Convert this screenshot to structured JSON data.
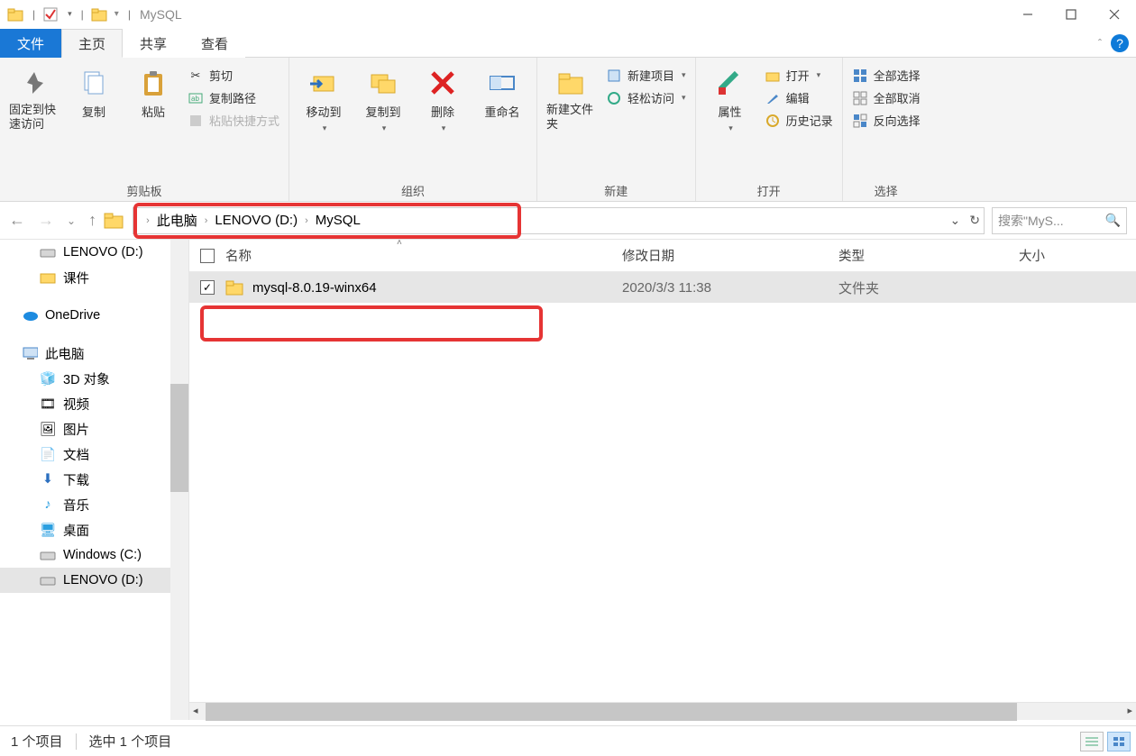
{
  "window": {
    "title": "MySQL",
    "min_tooltip": "最小化",
    "max_tooltip": "最大化",
    "close_tooltip": "关闭"
  },
  "tabs": {
    "file": "文件",
    "home": "主页",
    "share": "共享",
    "view": "查看"
  },
  "ribbon": {
    "clipboard": {
      "label": "剪贴板",
      "pin": "固定到快速访问",
      "copy": "复制",
      "paste": "粘贴",
      "cut": "剪切",
      "copy_path": "复制路径",
      "paste_shortcut": "粘贴快捷方式"
    },
    "organize": {
      "label": "组织",
      "move_to": "移动到",
      "copy_to": "复制到",
      "delete": "删除",
      "rename": "重命名"
    },
    "new": {
      "label": "新建",
      "new_folder": "新建文件夹",
      "new_item": "新建项目",
      "easy_access": "轻松访问"
    },
    "open": {
      "label": "打开",
      "properties": "属性",
      "open": "打开",
      "edit": "编辑",
      "history": "历史记录"
    },
    "select": {
      "label": "选择",
      "select_all": "全部选择",
      "select_none": "全部取消",
      "invert": "反向选择"
    }
  },
  "breadcrumb": {
    "pc": "此电脑",
    "drive": "LENOVO (D:)",
    "folder": "MySQL"
  },
  "search": {
    "placeholder": "搜索\"MyS..."
  },
  "tree": {
    "lenovo_d": "LENOVO (D:)",
    "courseware": "课件",
    "onedrive": "OneDrive",
    "this_pc": "此电脑",
    "threed": "3D 对象",
    "videos": "视频",
    "pictures": "图片",
    "documents": "文档",
    "downloads": "下载",
    "music": "音乐",
    "desktop": "桌面",
    "windows_c": "Windows (C:)",
    "lenovo_d2": "LENOVO (D:)"
  },
  "columns": {
    "name": "名称",
    "modified": "修改日期",
    "type": "类型",
    "size": "大小"
  },
  "rows": [
    {
      "name": "mysql-8.0.19-winx64",
      "modified": "2020/3/3 11:38",
      "type": "文件夹",
      "size": ""
    }
  ],
  "status": {
    "items": "1 个项目",
    "selected": "选中 1 个项目"
  }
}
